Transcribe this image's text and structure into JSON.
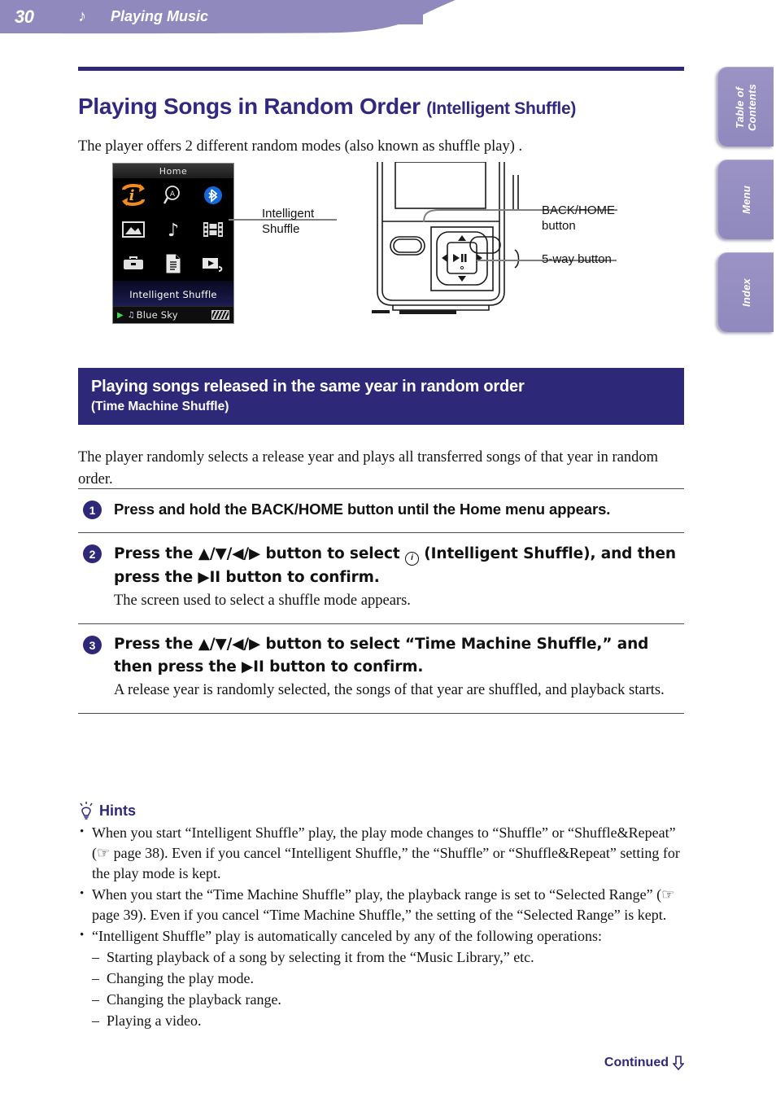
{
  "header": {
    "page_number": "30",
    "note_icon": "music-note-icon",
    "title": "Playing Music",
    "band_color": "#9089bd"
  },
  "side_tabs": [
    {
      "label": "Table of\nContents",
      "name": "table-of-contents"
    },
    {
      "label": "Menu",
      "name": "menu"
    },
    {
      "label": "Index",
      "name": "index"
    }
  ],
  "page": {
    "title_main": "Playing Songs in Random Order ",
    "title_sub": "(Intelligent Shuffle)",
    "title_color": "#31297e",
    "intro": "The player offers 2 different random modes (also known as shuffle play) ."
  },
  "figure": {
    "lcd": {
      "title": "Home",
      "icons": [
        "intelligent-shuffle-icon",
        "search-icon",
        "bluetooth-icon",
        "photo-icon",
        "music-icon",
        "video-icon",
        "settings-icon",
        "text-file-icon",
        "playlist-icon"
      ],
      "selected_label": "Intelligent Shuffle",
      "status": {
        "play_indicator": "▶",
        "note": "♫",
        "song": "Blue Sky",
        "battery": "battery-icon"
      }
    },
    "callouts": [
      {
        "name": "intelligent-shuffle-callout",
        "text": "Intelligent\nShuffle"
      },
      {
        "name": "back-home-button-callout",
        "text": "BACK/HOME\nbutton"
      },
      {
        "name": "five-way-button-callout",
        "text": "5-way button"
      }
    ]
  },
  "section": {
    "banner_line1": "Playing songs released in the same year in random order",
    "banner_line2": "(Time Machine Shuffle)",
    "banner_color": "#2e2878",
    "intro": "The player randomly selects a release year and plays all transferred songs of that year in random order."
  },
  "steps": [
    {
      "number": "1",
      "head": "Press and hold the BACK/HOME button until the Home menu appears.",
      "desc": ""
    },
    {
      "number": "2",
      "head_pre": "Press the ▲/▼/◀/▶ button to select ",
      "head_post": " (Intelligent Shuffle), and then press the ▶II button to confirm.",
      "head": "",
      "desc": "The screen used to select a shuffle mode appears."
    },
    {
      "number": "3",
      "head": "Press the ▲/▼/◀/▶ button to select “Time Machine Shuffle,” and then press the ▶II button to confirm.",
      "desc": "A release year is randomly selected, the songs of that year are shuffled, and playback starts."
    }
  ],
  "hints": {
    "title": "Hints",
    "icon": "lightbulb-icon",
    "items": [
      "When you start “Intelligent Shuffle” play, the play mode changes to “Shuffle” or “Shuffle&Repeat” (☞ page 38). Even if you cancel “Intelligent Shuffle,” the “Shuffle” or “Shuffle&Repeat” setting for the play mode is kept.",
      "When you start the “Time Machine Shuffle” play, the playback range is set to “Selected Range” (☞ page 39). Even if you cancel “Time Machine Shuffle,” the setting of the “Selected Range” is kept.",
      "“Intelligent Shuffle” play is automatically canceled by any of the following operations:"
    ],
    "sub_items": [
      "Starting playback of a song by selecting it from the “Music Library,” etc.",
      "Changing the play mode.",
      "Changing the playback range.",
      "Playing a video."
    ]
  },
  "footer": {
    "continued_label": "Continued",
    "arrow_icon": "down-arrow-icon"
  }
}
